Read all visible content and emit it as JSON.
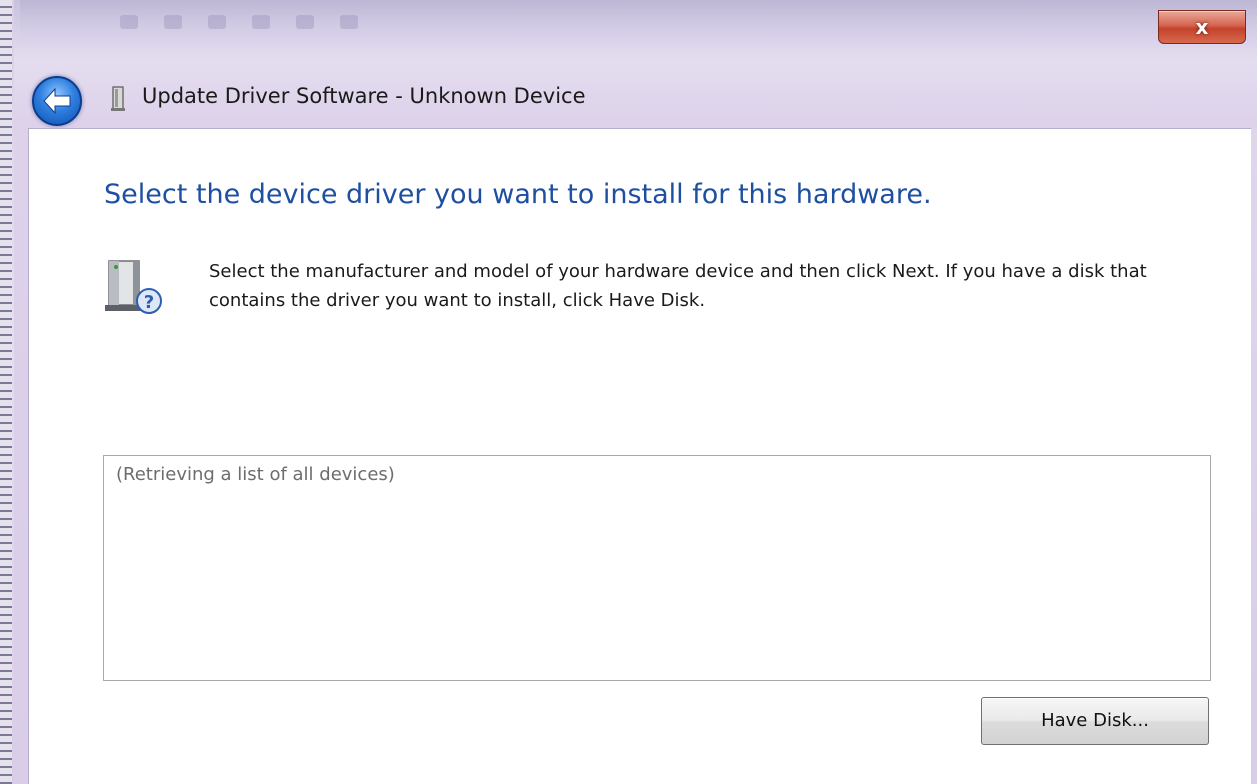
{
  "window": {
    "title": "Update Driver Software - Unknown Device",
    "close_label": "x"
  },
  "header": {
    "heading": "Select the device driver you want to install for this hardware.",
    "instructions": "Select the manufacturer and model of your hardware device and then click Next. If you have a disk that contains the driver you want to install, click Have Disk."
  },
  "device_list": {
    "placeholder": "(Retrieving a list of all devices)"
  },
  "buttons": {
    "have_disk": "Have Disk..."
  },
  "icons": {
    "back": "back-arrow-icon",
    "device": "device-icon",
    "hardware_help": "hardware-question-icon",
    "close": "close-icon"
  },
  "colors": {
    "heading": "#1e4fa0",
    "close_button": "#c4422b",
    "back_button": "#2f7fe0"
  }
}
